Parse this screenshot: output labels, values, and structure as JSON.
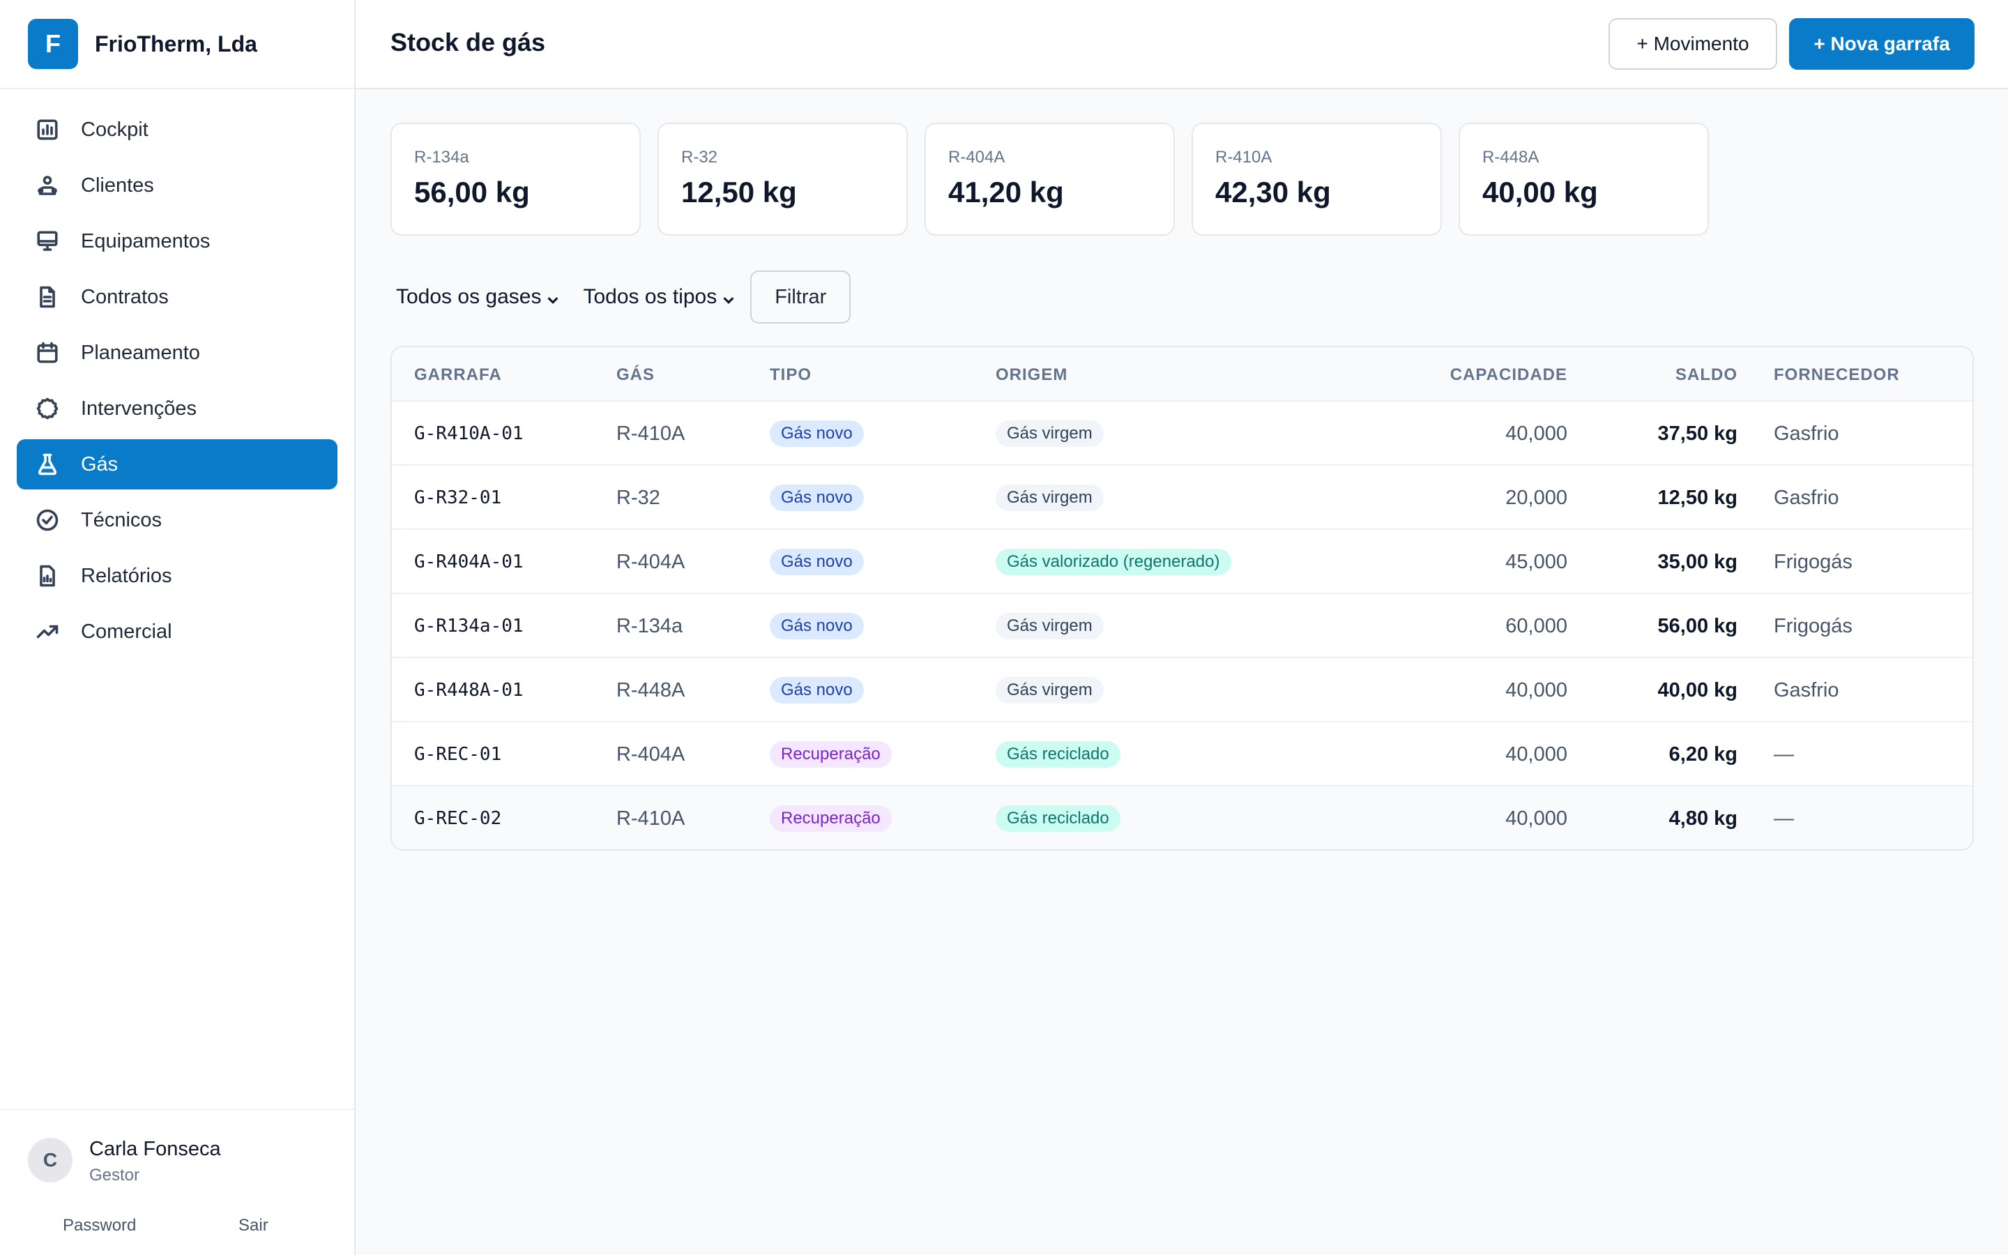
{
  "app": {
    "logo_letter": "F",
    "name": "FrioTherm, Lda"
  },
  "sidebar": {
    "items": [
      {
        "label": "Cockpit",
        "icon": "chart-bar-icon"
      },
      {
        "label": "Clientes",
        "icon": "user-group-icon"
      },
      {
        "label": "Equipamentos",
        "icon": "monitor-icon"
      },
      {
        "label": "Contratos",
        "icon": "document-icon"
      },
      {
        "label": "Planeamento",
        "icon": "calendar-icon"
      },
      {
        "label": "Intervenções",
        "icon": "gear-icon"
      },
      {
        "label": "Gás",
        "icon": "flask-icon",
        "active": true
      },
      {
        "label": "Técnicos",
        "icon": "check-circle-icon"
      },
      {
        "label": "Relatórios",
        "icon": "report-icon"
      },
      {
        "label": "Comercial",
        "icon": "trending-up-icon"
      }
    ]
  },
  "user": {
    "initial": "C",
    "name": "Carla Fonseca",
    "role": "Gestor",
    "password_label": "Password",
    "logout_label": "Sair"
  },
  "header": {
    "title": "Stock de gás",
    "movement_button": "+ Movimento",
    "new_bottle_button": "+ Nova garrafa"
  },
  "summary_cards": [
    {
      "gas": "R-134a",
      "amount": "56,00 kg"
    },
    {
      "gas": "R-32",
      "amount": "12,50 kg"
    },
    {
      "gas": "R-404A",
      "amount": "41,20 kg"
    },
    {
      "gas": "R-410A",
      "amount": "42,30 kg"
    },
    {
      "gas": "R-448A",
      "amount": "40,00 kg"
    }
  ],
  "filters": {
    "gas_select": "Todos os gases",
    "type_select": "Todos os tipos",
    "filter_button": "Filtrar"
  },
  "table": {
    "columns": [
      "GARRAFA",
      "GÁS",
      "TIPO",
      "ORIGEM",
      "CAPACIDADE",
      "SALDO",
      "FORNECEDOR"
    ],
    "rows": [
      {
        "garrafa": "G-R410A-01",
        "gas": "R-410A",
        "tipo": "Gás novo",
        "origem": "Gás virgem",
        "capacidade": "40,000",
        "saldo": "37,50 kg",
        "fornecedor": "Gasfrio"
      },
      {
        "garrafa": "G-R32-01",
        "gas": "R-32",
        "tipo": "Gás novo",
        "origem": "Gás virgem",
        "capacidade": "20,000",
        "saldo": "12,50 kg",
        "fornecedor": "Gasfrio"
      },
      {
        "garrafa": "G-R404A-01",
        "gas": "R-404A",
        "tipo": "Gás novo",
        "origem": "Gás valorizado (regenerado)",
        "capacidade": "45,000",
        "saldo": "35,00 kg",
        "fornecedor": "Frigogás"
      },
      {
        "garrafa": "G-R134a-01",
        "gas": "R-134a",
        "tipo": "Gás novo",
        "origem": "Gás virgem",
        "capacidade": "60,000",
        "saldo": "56,00 kg",
        "fornecedor": "Frigogás"
      },
      {
        "garrafa": "G-R448A-01",
        "gas": "R-448A",
        "tipo": "Gás novo",
        "origem": "Gás virgem",
        "capacidade": "40,000",
        "saldo": "40,00 kg",
        "fornecedor": "Gasfrio"
      },
      {
        "garrafa": "G-REC-01",
        "gas": "R-404A",
        "tipo": "Recuperação",
        "origem": "Gás reciclado",
        "capacidade": "40,000",
        "saldo": "6,20 kg",
        "fornecedor": "—"
      },
      {
        "garrafa": "G-REC-02",
        "gas": "R-410A",
        "tipo": "Recuperação",
        "origem": "Gás reciclado",
        "capacidade": "40,000",
        "saldo": "4,80 kg",
        "fornecedor": "—"
      }
    ]
  },
  "colors": {
    "primary": "#0a7bc8",
    "badge_novo_bg": "#dbeafe",
    "badge_novo_fg": "#1e40af",
    "badge_recuperacao_bg": "#f3e8ff",
    "badge_recuperacao_fg": "#7e22ce",
    "badge_virgem_bg": "#f1f5f9",
    "badge_virgem_fg": "#334155",
    "badge_regenerado_bg": "#ccfbf1",
    "badge_regenerado_fg": "#0f766e"
  }
}
